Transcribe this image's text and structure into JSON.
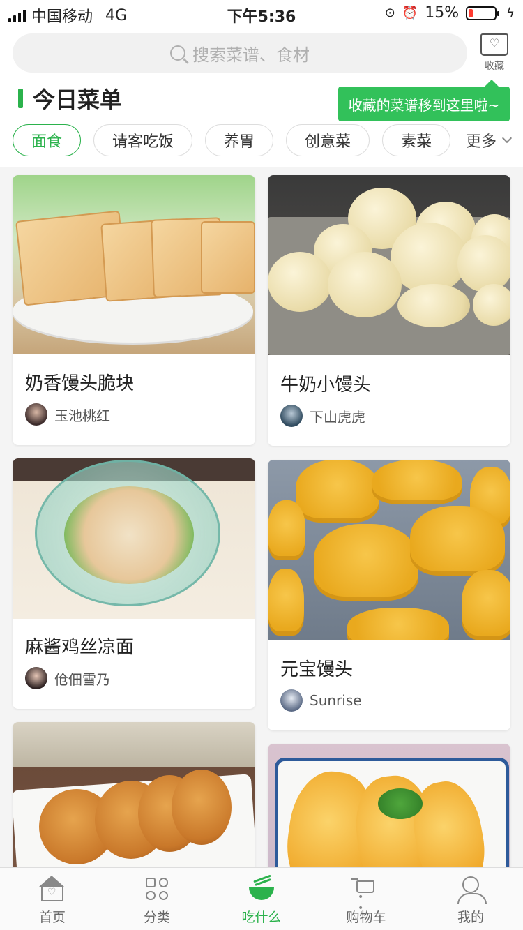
{
  "status_bar": {
    "carrier": "中国移动",
    "network": "4G",
    "time": "下午5:36",
    "battery": "15%",
    "battery_level": 0.15
  },
  "search": {
    "placeholder": "搜索菜谱、食材"
  },
  "favorites": {
    "label": "收藏",
    "icon": "folder-heart-icon"
  },
  "section": {
    "title": "今日菜单"
  },
  "tooltip": {
    "text": "收藏的菜谱移到这里啦~"
  },
  "categories": {
    "items": [
      "面食",
      "请客吃饭",
      "养胃",
      "创意菜",
      "素菜"
    ],
    "active": "面食",
    "more_label": "更多"
  },
  "recipes": [
    {
      "title": "奶香馒头脆块",
      "author": "玉池桃红",
      "image": "toast-slices-on-plate"
    },
    {
      "title": "牛奶小馒头",
      "author": "下山虎虎",
      "image": "steamed-buns-in-tray"
    },
    {
      "title": "麻酱鸡丝凉面",
      "author": "伧佃雪乃",
      "image": "cold-noodles-in-glass-bowl"
    },
    {
      "title": "元宝馒头",
      "author": "Sunrise",
      "image": "ingot-shaped-buns"
    },
    {
      "title": "",
      "author": "",
      "image": "fried-cakes-on-plate"
    },
    {
      "title": "",
      "author": "",
      "image": "egg-pancakes-on-plate"
    }
  ],
  "tabbar": {
    "items": [
      {
        "label": "首页",
        "icon": "home-icon"
      },
      {
        "label": "分类",
        "icon": "category-icon"
      },
      {
        "label": "吃什么",
        "icon": "bowl-icon"
      },
      {
        "label": "购物车",
        "icon": "cart-icon"
      },
      {
        "label": "我的",
        "icon": "user-icon"
      }
    ],
    "active": "吃什么"
  },
  "colors": {
    "accent": "#2bb24c",
    "tooltip": "#32c15a",
    "battery_low": "#ff3b30"
  }
}
